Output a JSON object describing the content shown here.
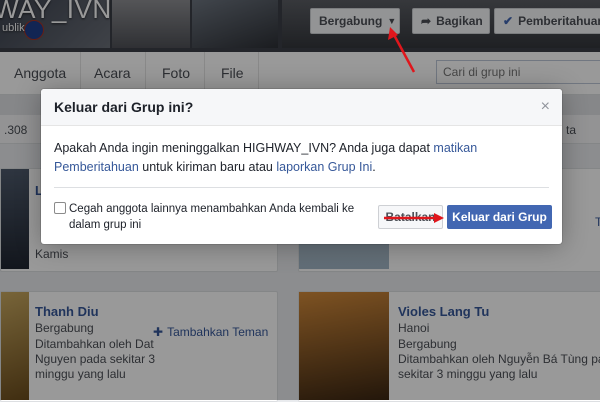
{
  "cover": {
    "title": "WAY_IVN",
    "subtitle": "ublik",
    "buttons": {
      "joined": "Bergabung",
      "share": "Bagikan",
      "notifications": "Pemberitahuan"
    }
  },
  "tabs": [
    "Anggota",
    "Acara",
    "Foto",
    "File"
  ],
  "search": {
    "placeholder": "Cari di grup ini"
  },
  "member_count_partial": ".308",
  "members": [
    {
      "name": "L",
      "lines": [
        "Kamis"
      ]
    },
    {
      "name": "Thanh Diu",
      "lines": [
        "Bergabung",
        "Ditambahkan oleh Dat",
        "Nguyen pada sekitar 3",
        "minggu yang lalu"
      ],
      "action": "Tambahkan Teman"
    },
    {
      "name": "Violes Lang Tu",
      "lines": [
        "Hanoi",
        "Bergabung",
        "Ditambahkan oleh Nguyễn Bá Tùng pada",
        "sekitar 3 minggu yang lalu"
      ]
    }
  ],
  "partial_right_text": "ta",
  "partial_right_action": "T",
  "modal": {
    "title": "Keluar dari Grup ini?",
    "close": "×",
    "body_part1": "Apakah Anda ingin meninggalkan HIGHWAY_IVN? Anda juga dapat ",
    "link1": "matikan Pemberitahuan",
    "body_part2": " untuk kiriman baru atau ",
    "link2": "laporkan Grup Ini",
    "body_part3": ".",
    "checkbox_label": "Cegah anggota lainnya menambahkan Anda kembali ke dalam grup ini",
    "cancel": "Batalkan",
    "leave": "Keluar dari Grup"
  },
  "colors": {
    "primary": "#4267b2",
    "link": "#365899",
    "annotation_arrow": "#e0161c"
  },
  "icons": {
    "dropdown": "caret-down-icon",
    "share": "share-arrow-icon",
    "check": "check-icon",
    "add_friend": "add-friend-icon"
  }
}
